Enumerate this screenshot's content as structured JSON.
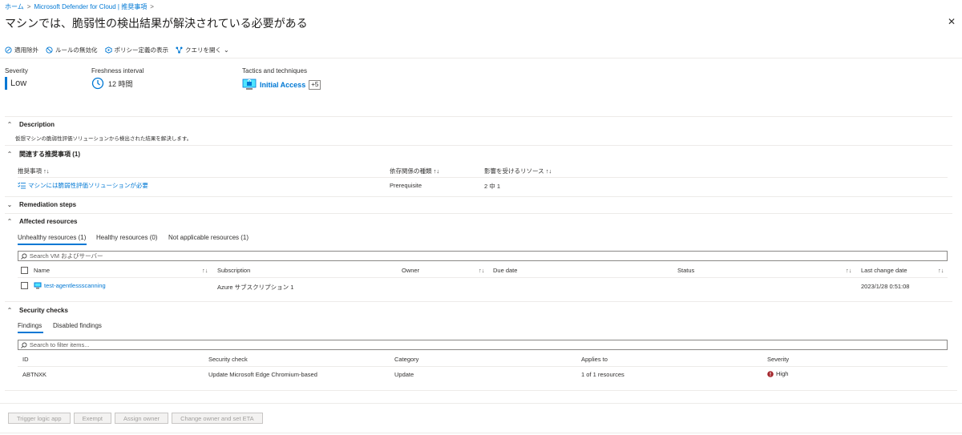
{
  "breadcrumb": {
    "items": [
      "ホーム",
      "Microsoft Defender for Cloud | 推奨事項"
    ],
    "separator": ">"
  },
  "page_title": "マシンでは、脆弱性の検出結果が解決されている必要がある",
  "more_label": "···",
  "close_label": "✕",
  "toolbar": {
    "exempt": "適用除外",
    "disable_rule": "ルールの無効化",
    "view_policy": "ポリシー定義の表示",
    "open_query": "クエリを開く"
  },
  "essentials": {
    "severity_label": "Severity",
    "severity_value": "Low",
    "freshness_label": "Freshness interval",
    "freshness_value": "12 時間",
    "tactics_label": "Tactics and techniques",
    "tactics_value": "Initial Access",
    "tactics_more": "+5"
  },
  "description": {
    "title": "Description",
    "text": "仮想マシンの脆弱性評価ソリューションから検出された結果を解決します。"
  },
  "related": {
    "title": "関連する推奨事項 (1)",
    "headers": [
      "推奨事項",
      "依存関係の種類",
      "影響を受けるリソース"
    ],
    "row": {
      "name": "マシンには脆弱性評価ソリューションが必要",
      "type": "Prerequisite",
      "affected": "2 中 1"
    }
  },
  "remediation": {
    "title": "Remediation steps"
  },
  "affected": {
    "title": "Affected resources",
    "tabs": [
      "Unhealthy resources (1)",
      "Healthy resources (0)",
      "Not applicable resources (1)"
    ],
    "search_placeholder": "Search VM およびサーバー",
    "headers": [
      "Name",
      "Subscription",
      "Owner",
      "Due date",
      "Status",
      "Last change date"
    ],
    "row": {
      "name": "test-agentlessscanning",
      "subscription": "Azure サブスクリプション 1",
      "owner": "",
      "due_date": "",
      "status": "",
      "last_change": "2023/1/28 0:51:08"
    }
  },
  "security_checks": {
    "title": "Security checks",
    "tabs": [
      "Findings",
      "Disabled findings"
    ],
    "search_placeholder": "Search to filter items...",
    "headers": [
      "ID",
      "Security check",
      "Category",
      "Applies to",
      "Severity"
    ],
    "row": {
      "id": "ABTNXK",
      "check": "Update Microsoft Edge Chromium-based",
      "category": "Update",
      "applies_to": "1 of 1 resources",
      "severity": "High"
    }
  },
  "actions": {
    "trigger": "Trigger logic app",
    "exempt": "Exempt",
    "assign_owner": "Assign owner",
    "change_owner": "Change owner and set ETA"
  },
  "colors": {
    "accent": "#0078d4",
    "severity_high": "#a4262c",
    "severity_low": "#0078d4"
  }
}
